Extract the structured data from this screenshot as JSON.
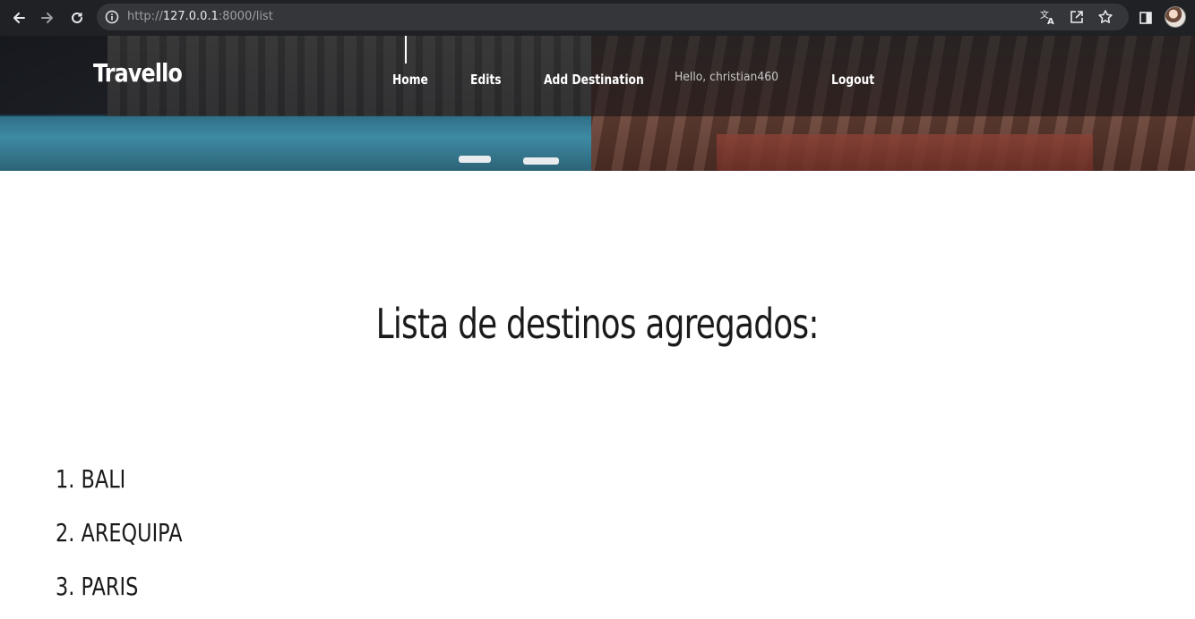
{
  "browser": {
    "url": {
      "scheme": "http://",
      "host": "127.0.0.1",
      "path": ":8000/list"
    },
    "icons": {
      "back": "arrow-left-icon",
      "forward": "arrow-right-icon",
      "reload": "reload-icon",
      "site_info": "info-icon",
      "translate": "translate-icon",
      "share": "share-icon",
      "bookmark": "star-icon",
      "side_panel": "side-panel-icon",
      "profile": "profile-avatar"
    }
  },
  "header": {
    "brand": "Travello",
    "nav": [
      {
        "label": "Home",
        "active": true
      },
      {
        "label": "Edits"
      },
      {
        "label": "Add Destination"
      },
      {
        "label": "Logout"
      }
    ],
    "greeting": "Hello, christian460"
  },
  "main": {
    "title": "Lista de destinos agregados:",
    "destinations": [
      {
        "number": "1.",
        "name": "BALI"
      },
      {
        "number": "2.",
        "name": "AREQUIPA"
      },
      {
        "number": "3.",
        "name": "PARIS"
      }
    ]
  },
  "colors": {
    "browser_bar": "#202124",
    "omnibox": "#35363a",
    "nav_text": "#ffffff",
    "greeting_text": "#c8c8c8",
    "body_text": "#1a1a1a",
    "page_background": "#ffffff"
  }
}
